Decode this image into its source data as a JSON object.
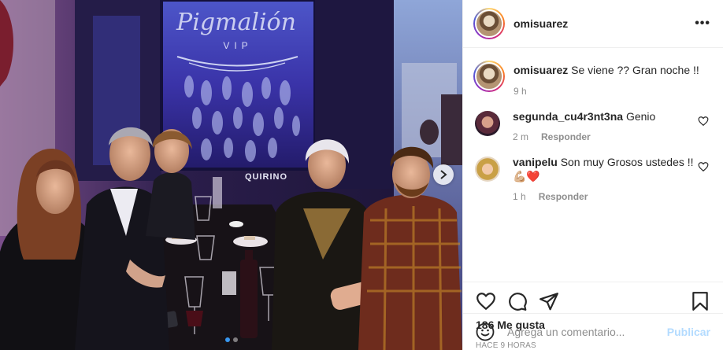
{
  "post": {
    "username": "omisuarez",
    "more_icon": "more-horizontal-icon",
    "caption_username": "omisuarez",
    "caption_text": "Se viene ?? Gran noche !!",
    "caption_time": "9 h",
    "carousel": {
      "total_slides": 2,
      "current_slide": 1
    }
  },
  "comments": [
    {
      "username": "segunda_cu4r3nt3na",
      "text": "Genio",
      "time": "2 m",
      "reply_label": "Responder"
    },
    {
      "username": "vanipelu",
      "text": "Son muy Grosos ustedes !! 💪🏼❤️",
      "time": "1 h",
      "reply_label": "Responder"
    }
  ],
  "actions": {
    "icons": [
      "heart-icon",
      "comment-icon",
      "share-icon",
      "bookmark-icon"
    ],
    "likes": "186 Me gusta",
    "timestamp": "HACE 9 HORAS"
  },
  "add_comment": {
    "placeholder": "Agrega un comentario...",
    "publish_label": "Publicar",
    "emoji_icon": "emoji-icon"
  },
  "photo": {
    "description_signage": "Pigmalión VIP",
    "sign_text_lower": "QUIRINO"
  },
  "colors": {
    "link_disabled": "#b3dbff",
    "active_dot": "#3897f0",
    "muted_text": "#8e8e8e",
    "like_heart": "#ed4956"
  }
}
